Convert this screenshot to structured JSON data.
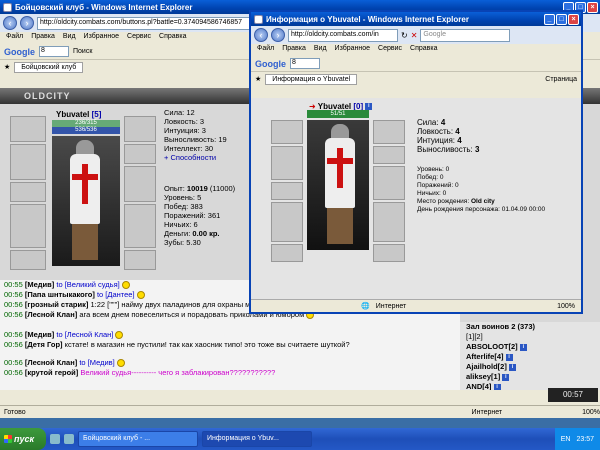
{
  "main_window": {
    "title": "Бойцовский клуб - Windows Internet Explorer",
    "url": "http://oldcity.combats.com/buttons.pl?battle=0.374094586746857",
    "menu": [
      "Файл",
      "Правка",
      "Вид",
      "Избранное",
      "Сервис",
      "Справка"
    ],
    "google_label": "Google",
    "google_input": "8",
    "search_label": "Поиск",
    "tab_label": "Бойцовский клуб",
    "site_header": "OLDCITY",
    "status_left": "Готово",
    "status_zone": "Интернет",
    "zoom": "100%",
    "clock_display": "00:57"
  },
  "character": {
    "name": "Ybuvatel",
    "level": "[5]",
    "hp": "236/315",
    "mana": "536/536",
    "stats": [
      {
        "label": "Сила:",
        "value": "12"
      },
      {
        "label": "Ловкость:",
        "value": "3"
      },
      {
        "label": "Интуиция:",
        "value": "3"
      },
      {
        "label": "Выносливость:",
        "value": "19"
      },
      {
        "label": "Интеллект:",
        "value": "30"
      }
    ],
    "abilities_link": "+ Способности",
    "exp_label": "Опыт:",
    "exp_value": "10019",
    "exp_next": "(11000)",
    "level_label": "Уровень:",
    "level_value": "5",
    "wins_label": "Побед:",
    "wins_value": "383",
    "losses_label": "Поражений:",
    "losses_value": "361",
    "draws_label": "Ничьих:",
    "draws_value": "6",
    "money_label": "Деньги:",
    "money_value": "0.00 кр.",
    "teeth_label": "Зубы:",
    "teeth_value": "5.30"
  },
  "chat": [
    {
      "time": "00:55",
      "nick": "[Медив]",
      "to": "to [Великий судья]",
      "msg": ""
    },
    {
      "time": "00:56",
      "nick": "[Папа шнтыкакого]",
      "to": "to [Дантее]",
      "msg": ""
    },
    {
      "time": "00:56",
      "nick": "[грозный старик]",
      "to": "",
      "msg": "1:22 [\"\"\"] найму двух паладинов для охраны меня от вампиров"
    },
    {
      "time": "00:56",
      "nick": "[Лесной Клан]",
      "to": "",
      "msg": "ага всем днем повеселиться и порадовать приколами и юмором"
    },
    {
      "time": "00:56",
      "nick": "[Медив]",
      "to": "to [Лесной Клан]",
      "msg": ""
    },
    {
      "time": "00:56",
      "nick": "[Детя Гор]",
      "to": "",
      "msg": "кстате! в магазин не пустили! так как хаосник типо! это тоже вы считаете шуткой?"
    },
    {
      "time": "00:56",
      "nick": "[Лесной Клан]",
      "to": "to [Медив]",
      "msg": ""
    },
    {
      "time": "00:56",
      "nick": "[крутой герой]",
      "to": "",
      "msg": "Великий судья---------- чего я заблакирован???????????"
    }
  ],
  "online": {
    "header": "Зал воинов 2 (373)",
    "pages": "[1][2]",
    "users": [
      "ABSOLOOT[2]",
      "Afterlife[4]",
      "Ajailhold[2]",
      "aliksey[1]",
      "AND[4]"
    ]
  },
  "popup": {
    "title": "Информация о Ybuvatel - Windows Internet Explorer",
    "url": "http://oldcity.combats.com/in",
    "search_placeholder": "Google",
    "tab_label": "Информация о Ybuvatel",
    "page_label": "Страница",
    "name": "Ybuvatel",
    "level": "[0]",
    "hp": "51/51",
    "stats": [
      {
        "label": "Сила:",
        "value": "4"
      },
      {
        "label": "Ловкость:",
        "value": "4"
      },
      {
        "label": "Интуиция:",
        "value": "4"
      },
      {
        "label": "Выносливость:",
        "value": "3"
      }
    ],
    "info": [
      {
        "label": "Уровень:",
        "value": "0"
      },
      {
        "label": "Побед:",
        "value": "0"
      },
      {
        "label": "Поражений:",
        "value": "0"
      },
      {
        "label": "Ничьих:",
        "value": "0"
      },
      {
        "label": "Место рождения:",
        "value": "Old city"
      },
      {
        "label": "День рождения персонажа:",
        "value": "01.04.09 00:00"
      }
    ],
    "status_zone": "Интернет",
    "zoom": "100%"
  },
  "taskbar": {
    "start": "пуск",
    "tasks": [
      "Бойцовский клуб - ...",
      "Информация о Ybuv..."
    ],
    "lang": "EN",
    "time": "23:57"
  },
  "colors": {
    "titlebar": "#0043b0",
    "hp": "#2a8a3a",
    "chat_time": "#006600",
    "link": "#0000cc"
  }
}
